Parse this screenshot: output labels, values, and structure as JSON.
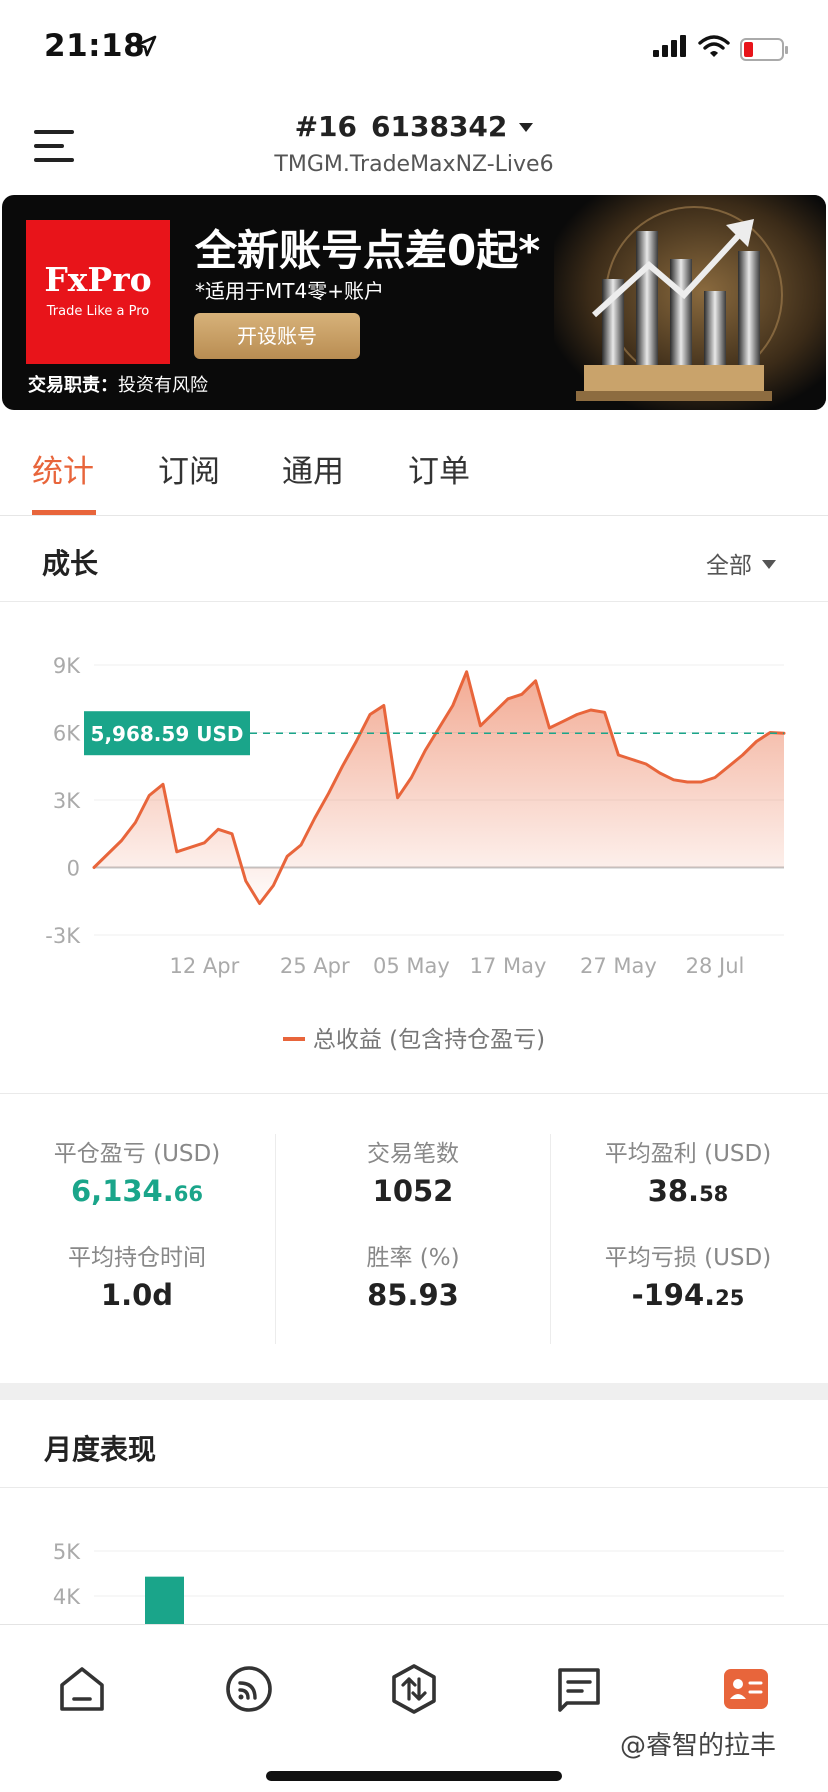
{
  "status_bar": {
    "time": "21:18"
  },
  "header": {
    "account_number": "#16",
    "account_id": "6138342",
    "server": "TMGM.TradeMaxNZ-Live6"
  },
  "ad": {
    "logo_main": "FxPro",
    "logo_sub": "Trade Like a Pro",
    "headline": "全新账号点差0起*",
    "subline": "*适用于MT4零+账户",
    "cta": "开设账号",
    "disclaimer_bold": "交易职责：",
    "disclaimer": "投资有风险"
  },
  "tabs": [
    {
      "label": "统计",
      "active": true
    },
    {
      "label": "订阅",
      "active": false
    },
    {
      "label": "通用",
      "active": false
    },
    {
      "label": "订单",
      "active": false
    }
  ],
  "growth": {
    "title": "成长",
    "range": "全部",
    "legend": "总收益 (包含持仓盈亏)",
    "current_label": "5,968.59 USD"
  },
  "chart_data": {
    "type": "area",
    "y_ticks": [
      "9K",
      "6K",
      "3K",
      "0",
      "-3K"
    ],
    "y_tick_values": [
      9000,
      6000,
      3000,
      0,
      -3000
    ],
    "x_tick_labels": [
      "12 Apr",
      "25 Apr",
      "05 May",
      "17 May",
      "27 May",
      "28 Jul"
    ],
    "x_tick_index": [
      8,
      16,
      23,
      30,
      38,
      45
    ],
    "ylim": [
      -3000,
      9000
    ],
    "reference_value": 5968.59,
    "series": [
      {
        "name": "总收益 (包含持仓盈亏)",
        "color": "#e8653b",
        "values": [
          0,
          600,
          1200,
          2000,
          3200,
          3700,
          700,
          900,
          1100,
          1700,
          1500,
          -600,
          -1600,
          -800,
          500,
          1000,
          2200,
          3300,
          4500,
          5600,
          6800,
          7200,
          3100,
          4000,
          5200,
          6200,
          7200,
          8700,
          6300,
          6900,
          7500,
          7700,
          8300,
          6200,
          6500,
          6800,
          7000,
          6900,
          5000,
          4800,
          4600,
          4200,
          3900,
          3800,
          3800,
          4000,
          4500,
          5000,
          5600,
          6000,
          5968.59
        ]
      }
    ]
  },
  "stats": [
    {
      "label": "平仓盈亏 (USD)",
      "value_main": "6,134.",
      "value_dec": "66",
      "green": true
    },
    {
      "label": "交易笔数",
      "value_main": "1052",
      "value_dec": "",
      "green": false
    },
    {
      "label": "平均盈利 (USD)",
      "value_main": "38.",
      "value_dec": "58",
      "green": false
    },
    {
      "label": "平均持仓时间",
      "value_main": "1.0d",
      "value_dec": "",
      "green": false
    },
    {
      "label": "胜率 (%)",
      "value_main": "85.93",
      "value_dec": "",
      "green": false
    },
    {
      "label": "平均亏损 (USD)",
      "value_main": "-194.",
      "value_dec": "25",
      "green": false
    }
  ],
  "monthly": {
    "title": "月度表现",
    "chart_data": {
      "type": "bar",
      "y_ticks": [
        "5K",
        "4K"
      ],
      "y_tick_values": [
        5000,
        4000
      ],
      "ylim": [
        3000,
        5500
      ],
      "values": [
        4430
      ],
      "color": "#1aa58a"
    }
  },
  "watermark": "@睿智的拉丰"
}
